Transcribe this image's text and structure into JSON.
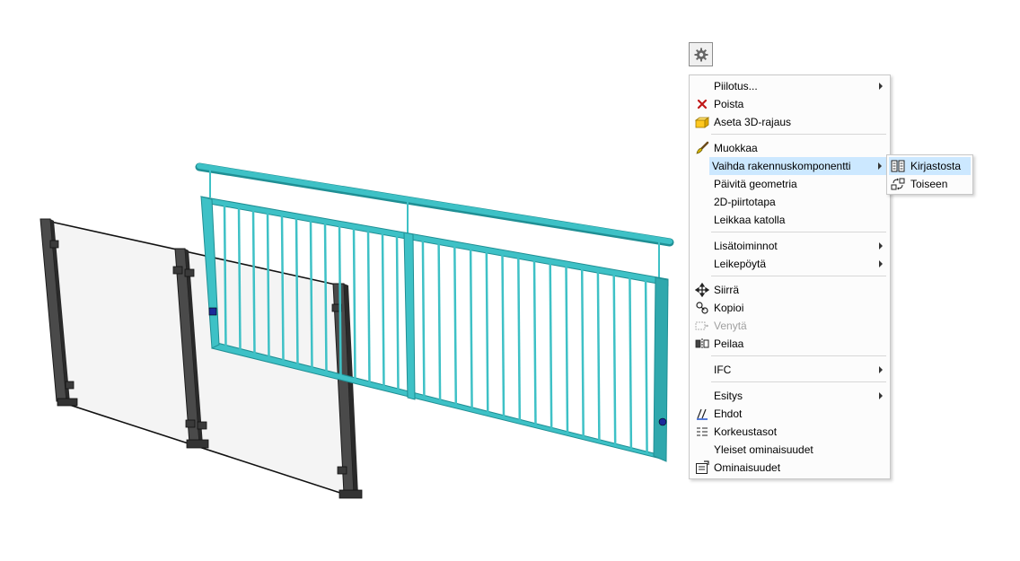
{
  "toolbar": {
    "settings_icon": "gear-icon"
  },
  "context_menu": {
    "items": [
      {
        "label": "Piilotus...",
        "icon": "",
        "submenu": true
      },
      {
        "label": "Poista",
        "icon": "delete-x-icon"
      },
      {
        "label": "Aseta 3D-rajaus",
        "icon": "3d-clip-icon"
      },
      {
        "label": "Muokkaa",
        "icon": "edit-brush-icon"
      },
      {
        "label": "Vaihda rakennuskomponentti",
        "icon": "",
        "submenu": true,
        "highlighted": true
      },
      {
        "label": "Päivitä geometria",
        "icon": ""
      },
      {
        "label": "2D-piirtotapa",
        "icon": ""
      },
      {
        "label": "Leikkaa katolla",
        "icon": ""
      },
      {
        "label": "Lisätoiminnot",
        "icon": "",
        "submenu": true
      },
      {
        "label": "Leikepöytä",
        "icon": "",
        "submenu": true
      },
      {
        "label": "Siirrä",
        "icon": "move-icon"
      },
      {
        "label": "Kopioi",
        "icon": "copy-icon"
      },
      {
        "label": "Venytä",
        "icon": "stretch-icon",
        "disabled": true
      },
      {
        "label": "Peilaa",
        "icon": "mirror-icon"
      },
      {
        "label": "IFC",
        "icon": "",
        "submenu": true
      },
      {
        "label": "Esitys",
        "icon": "",
        "submenu": true
      },
      {
        "label": "Ehdot",
        "icon": "conditions-icon"
      },
      {
        "label": "Korkeustasot",
        "icon": "levels-icon"
      },
      {
        "label": "Yleiset ominaisuudet",
        "icon": ""
      },
      {
        "label": "Ominaisuudet",
        "icon": "properties-icon"
      }
    ]
  },
  "submenu": {
    "items": [
      {
        "label": "Kirjastosta",
        "icon": "library-icon",
        "highlighted": true
      },
      {
        "label": "Toiseen",
        "icon": "swap-icon"
      }
    ]
  },
  "colors": {
    "railing": "#3ec1c6",
    "railing_dark": "#1f8f94",
    "post": "#3c3c3c",
    "highlight": "#cce8ff"
  }
}
